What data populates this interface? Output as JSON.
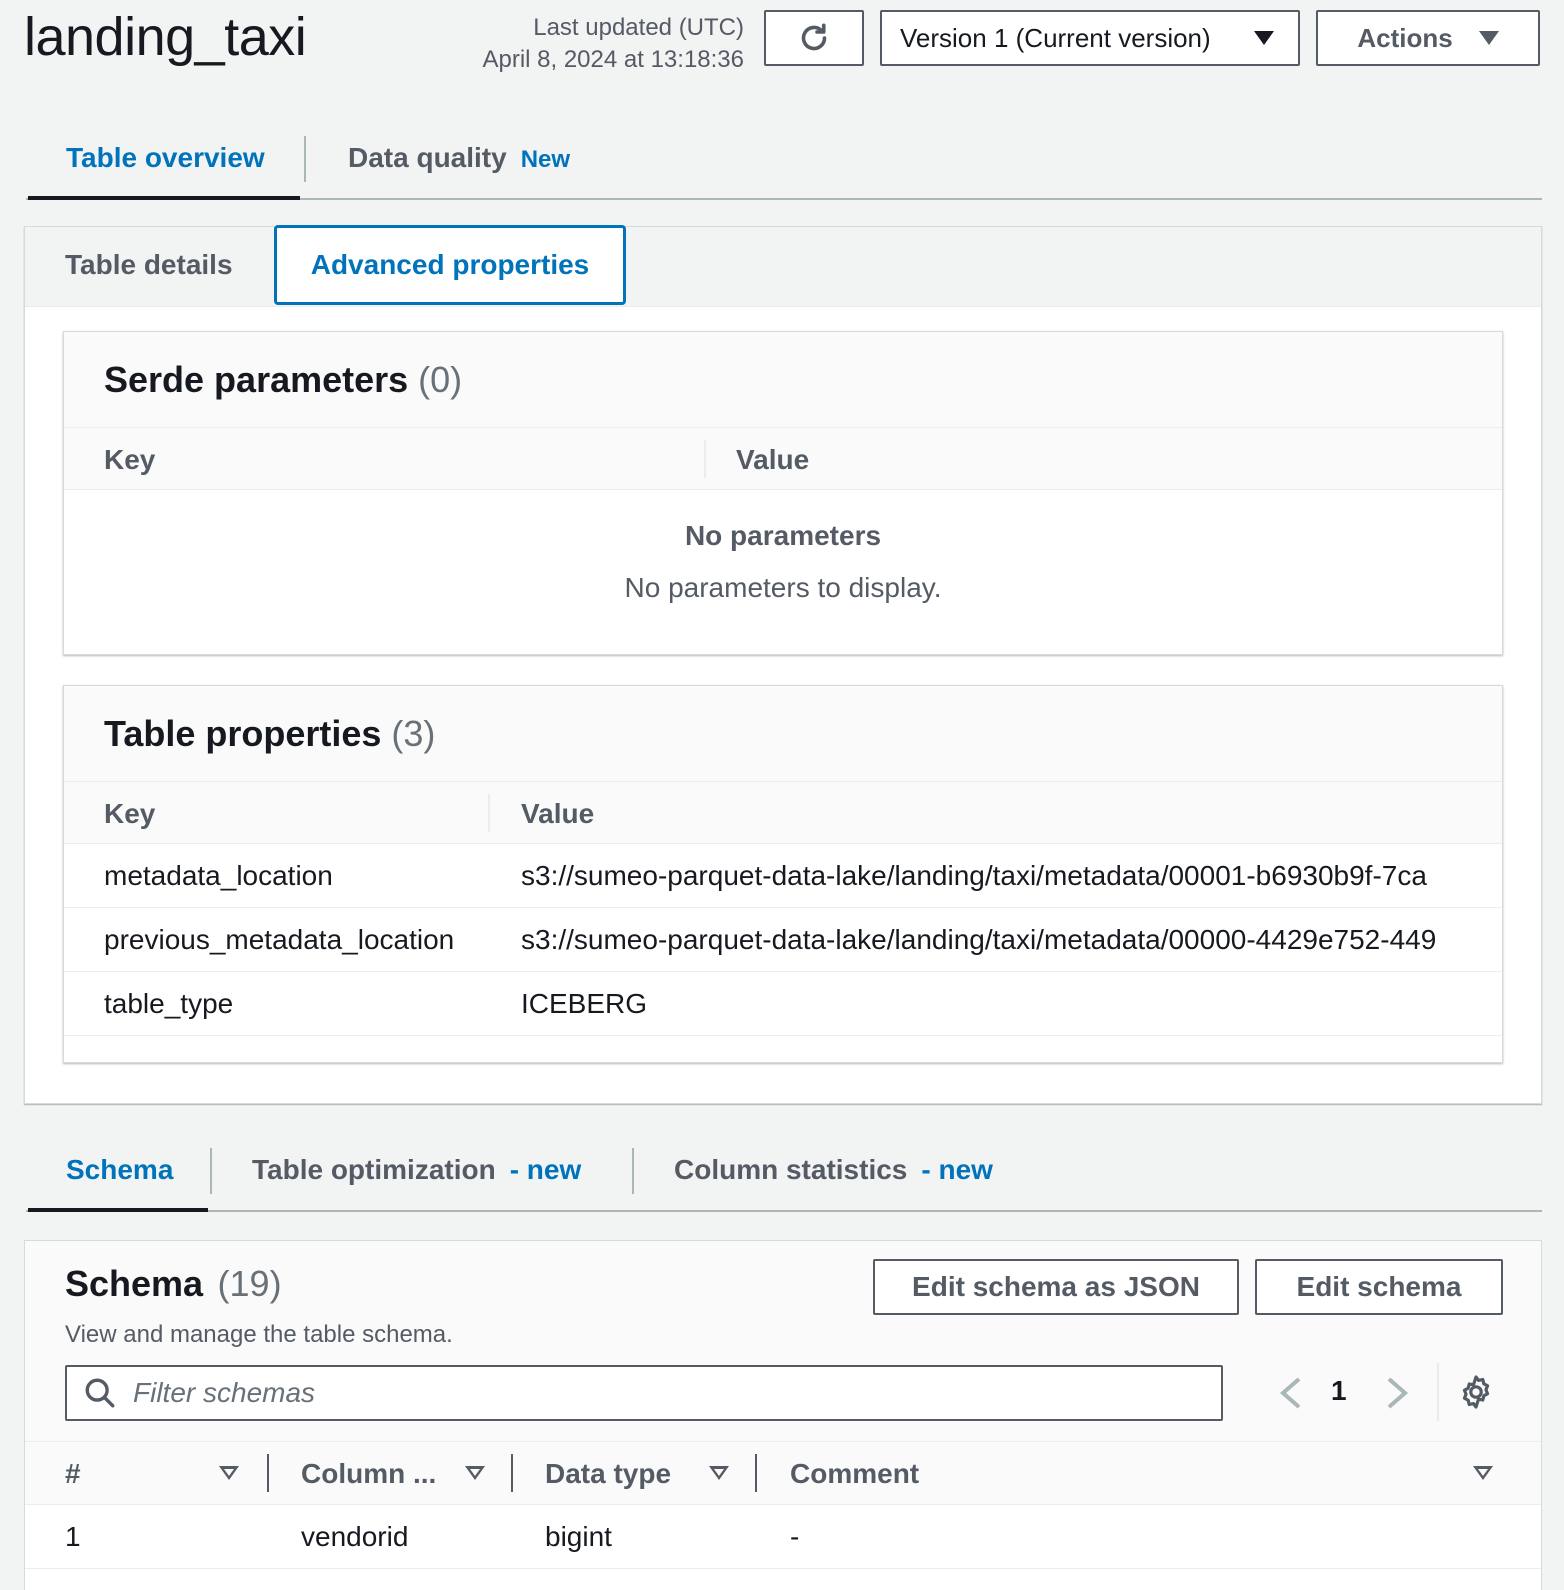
{
  "header": {
    "title": "landing_taxi",
    "last_updated_label": "Last updated (UTC)",
    "last_updated_value": "April 8, 2024 at 13:18:36",
    "version_label": "Version 1 (Current version)",
    "actions_label": "Actions"
  },
  "main_tabs": {
    "overview": "Table overview",
    "quality": "Data quality",
    "quality_badge": "New"
  },
  "sub_tabs": {
    "details": "Table details",
    "advanced": "Advanced properties"
  },
  "serde": {
    "title": "Serde parameters",
    "count": "(0)",
    "col_key": "Key",
    "col_value": "Value",
    "empty_title": "No parameters",
    "empty_text": "No parameters to display."
  },
  "table_props": {
    "title": "Table properties",
    "count": "(3)",
    "col_key": "Key",
    "col_value": "Value",
    "rows": [
      {
        "key": "metadata_location",
        "value": "s3://sumeo-parquet-data-lake/landing/taxi/metadata/00001-b6930b9f-7ca"
      },
      {
        "key": "previous_metadata_location",
        "value": "s3://sumeo-parquet-data-lake/landing/taxi/metadata/00000-4429e752-449"
      },
      {
        "key": "table_type",
        "value": "ICEBERG"
      }
    ]
  },
  "schema_tabs": {
    "schema": "Schema",
    "optimization": "Table optimization",
    "optimization_badge": "- new",
    "stats": "Column statistics",
    "stats_badge": "- new"
  },
  "schema": {
    "title": "Schema",
    "count": "(19)",
    "description": "View and manage the table schema.",
    "edit_json_label": "Edit schema as JSON",
    "edit_label": "Edit schema",
    "filter_placeholder": "Filter schemas",
    "page": "1",
    "columns": [
      "#",
      "Column ...",
      "Data type",
      "Comment"
    ],
    "rows": [
      {
        "num": "1",
        "name": "vendorid",
        "type": "bigint",
        "comment": "-"
      }
    ]
  },
  "icons": {
    "refresh": "refresh-icon",
    "search": "search-icon",
    "settings": "gear-icon",
    "prev": "chevron-left-icon",
    "next": "chevron-right-icon"
  }
}
